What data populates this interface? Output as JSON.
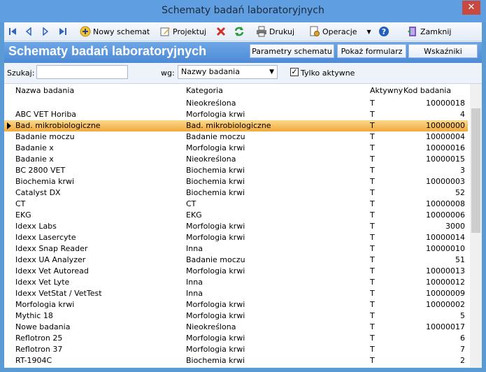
{
  "window": {
    "title": "Schematy badań laboratoryjnych",
    "close_glyph": "✕"
  },
  "toolbar": {
    "new_label": "Nowy schemat",
    "design_label": "Projektuj",
    "print_label": "Drukuj",
    "operations_label": "Operacje",
    "close_label": "Zamknij"
  },
  "header": {
    "title": "Schematy badań laboratoryjnych",
    "params_label": "Parametry schematu",
    "show_form_label": "Pokaż formularz",
    "indicators_label": "Wskaźniki"
  },
  "search": {
    "label": "Szukaj:",
    "value": "",
    "by_label": "wg:",
    "by_value": "Nazwy badania",
    "only_active_label": "Tylko aktywne",
    "only_active_checked": true
  },
  "grid": {
    "columns": [
      "Nazwa badania",
      "Kategoria",
      "Aktywny",
      "Kod badania"
    ],
    "selected_index": 2,
    "rows": [
      [
        "",
        "Nieokreślona",
        "T",
        "10000018"
      ],
      [
        "ABC VET Horiba",
        "Morfologia krwi",
        "T",
        "4"
      ],
      [
        "Bad. mikrobiologiczne",
        "Bad. mikrobiologiczne",
        "T",
        "10000000"
      ],
      [
        "Badanie moczu",
        "Badanie moczu",
        "T",
        "10000004"
      ],
      [
        "Badanie x",
        "Morfologia krwi",
        "T",
        "10000016"
      ],
      [
        "Badanie x",
        "Nieokreślona",
        "T",
        "10000015"
      ],
      [
        "BC 2800 VET",
        "Biochemia krwi",
        "T",
        "3"
      ],
      [
        "Biochemia krwi",
        "Biochemia krwi",
        "T",
        "10000003"
      ],
      [
        "Catalyst DX",
        "Biochemia krwi",
        "T",
        "52"
      ],
      [
        "CT",
        "CT",
        "T",
        "10000008"
      ],
      [
        "EKG",
        "EKG",
        "T",
        "10000006"
      ],
      [
        "Idexx Labs",
        "Morfologia krwi",
        "T",
        "3000"
      ],
      [
        "Idexx Lasercyte",
        "Morfologia krwi",
        "T",
        "10000014"
      ],
      [
        "Idexx Snap Reader",
        "Inna",
        "T",
        "10000010"
      ],
      [
        "Idexx UA Analyzer",
        "Badanie moczu",
        "T",
        "51"
      ],
      [
        "Idexx Vet Autoread",
        "Morfologia krwi",
        "T",
        "10000013"
      ],
      [
        "Idexx Vet Lyte",
        "Inna",
        "T",
        "10000012"
      ],
      [
        "Idexx VetStat / VetTest",
        "Inna",
        "T",
        "10000009"
      ],
      [
        "Morfologia krwi",
        "Morfologia krwi",
        "T",
        "10000002"
      ],
      [
        "Mythic 18",
        "Morfologia krwi",
        "T",
        "5"
      ],
      [
        "Nowe badania",
        "Nieokreślona",
        "T",
        "10000017"
      ],
      [
        "Reflotron 25",
        "Morfologia krwi",
        "T",
        "6"
      ],
      [
        "Reflotron 37",
        "Morfologia krwi",
        "T",
        "7"
      ],
      [
        "RT-1904C",
        "Biochemia krwi",
        "T",
        "2"
      ]
    ]
  }
}
